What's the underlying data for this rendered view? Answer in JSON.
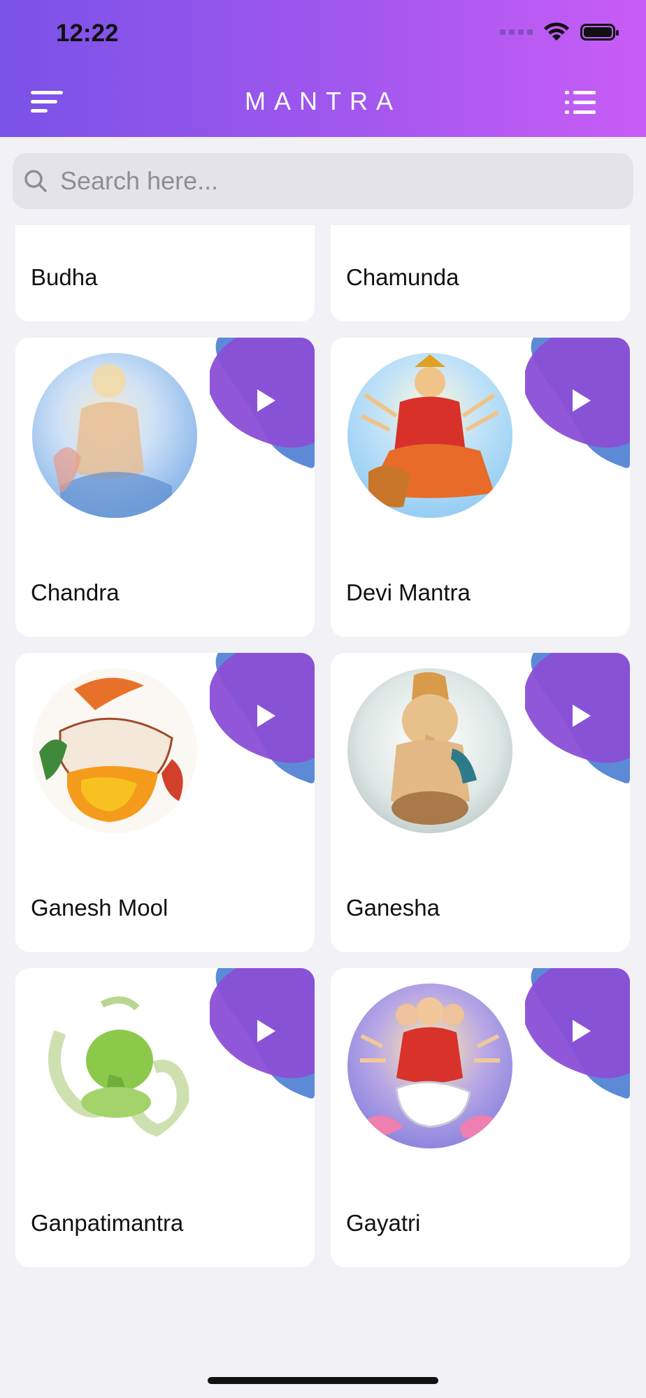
{
  "status_bar": {
    "time": "12:22"
  },
  "header": {
    "title": "MANTRA"
  },
  "search": {
    "placeholder": "Search here..."
  },
  "cards": [
    {
      "label": "Budha"
    },
    {
      "label": "Chamunda"
    },
    {
      "label": "Chandra"
    },
    {
      "label": "Devi Mantra"
    },
    {
      "label": "Ganesh Mool"
    },
    {
      "label": "Ganesha"
    },
    {
      "label": "Ganpatimantra"
    },
    {
      "label": "Gayatri"
    }
  ],
  "colors": {
    "header_gradient_start": "#7a52e8",
    "header_gradient_end": "#c85df6",
    "play_blob_purple": "#8a4fd6",
    "play_blob_blue": "#5c8ad6",
    "background": "#f2f1f6"
  }
}
